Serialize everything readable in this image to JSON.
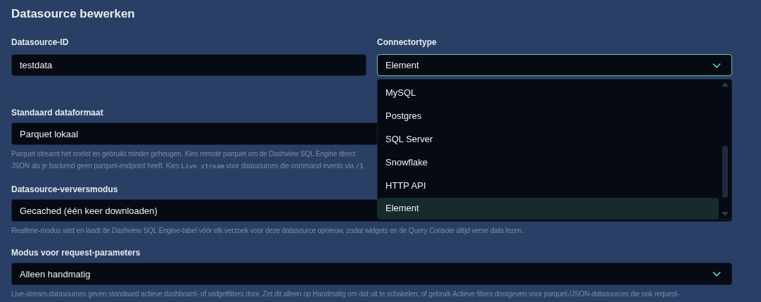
{
  "dialog": {
    "title": "Datasource bewerken"
  },
  "top_fields": [
    {
      "label": "Datasource-ID",
      "kind": "text",
      "value": "testdata",
      "focused": false
    },
    {
      "label": "Connectortype",
      "kind": "select",
      "value": "Element",
      "focused": true,
      "open": true,
      "options": [
        {
          "label": "MySQL",
          "selected": false
        },
        {
          "label": "Postgres",
          "selected": false
        },
        {
          "label": "SQL Server",
          "selected": false
        },
        {
          "label": "Snowflake",
          "selected": false
        },
        {
          "label": "HTTP API",
          "selected": false
        },
        {
          "label": "Element",
          "selected": true
        }
      ]
    }
  ],
  "fields": [
    {
      "label": "Standaard dataformaat",
      "kind": "select",
      "value": "Parquet lokaal",
      "help": [
        [
          {
            "kind": "text",
            "text": "Parquet streamt het snelst en gebruikt minder geheugen. Kies remote parquet om de Dashview SQL Engine direct"
          }
        ],
        [
          {
            "kind": "text",
            "text": "JSON als je backend geen parquet-endpoint heeft. Kies "
          },
          {
            "kind": "code",
            "text": "Live stream"
          },
          {
            "kind": "text",
            "text": " voor datasources die command events via "
          },
          {
            "kind": "code",
            "text": "/1"
          }
        ]
      ]
    },
    {
      "label": "Datasource-verversmodus",
      "kind": "select",
      "value": "Gecached (één keer downloaden)",
      "help": [
        [
          {
            "kind": "text",
            "text": "Realtime-modus wist en laadt de Dashview SQL Engine-tabel vóór elk verzoek voor deze datasource opnieuw, zodat widgets en de Query Console altijd verse data lezen."
          }
        ]
      ]
    },
    {
      "label": "Modus voor request-parameters",
      "kind": "select",
      "value": "Alleen handmatig",
      "help": [
        [
          {
            "kind": "text",
            "text": "Live-stream-datasources geven standaard actieve dashboard- of widgetfilters door. Zet dit alleen op Handmatig om dat uit te schakelen, of gebruik Actieve filters doorgeven voor parquet-/JSON-datasources die ook request-"
          }
        ]
      ]
    }
  ]
}
